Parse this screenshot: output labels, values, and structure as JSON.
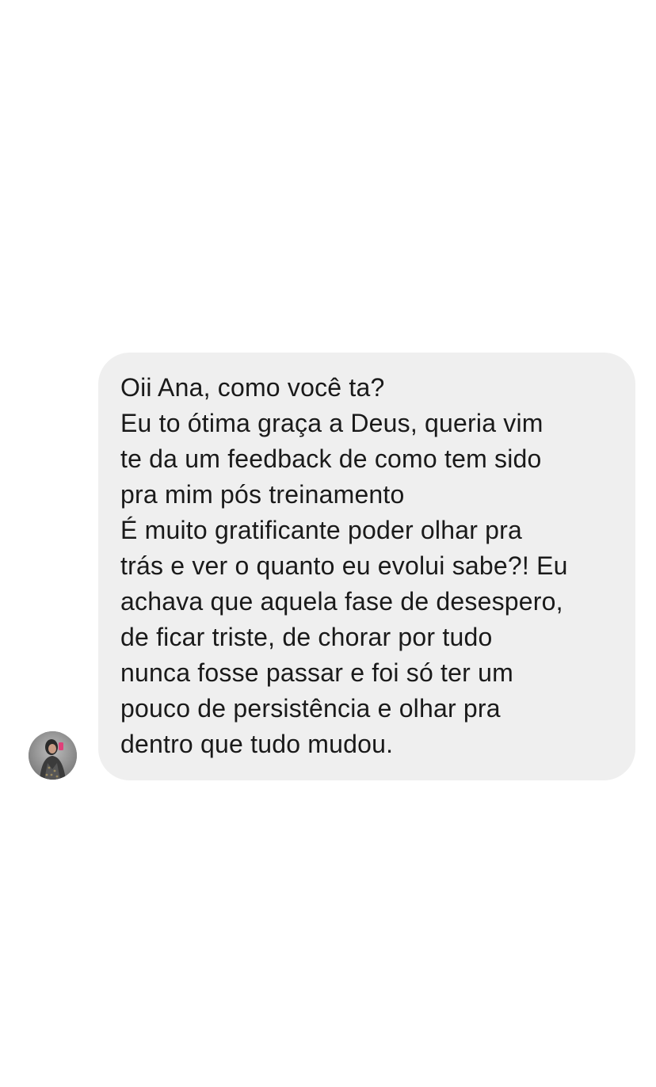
{
  "conversation": {
    "message": {
      "lines": [
        "Oii Ana, como você ta?",
        "Eu to ótima graça a Deus, queria vim",
        "te da um feedback de como tem sido",
        "pra mim pós  treinamento",
        "É muito gratificante poder olhar pra",
        "trás e ver o quanto eu evolui sabe?! Eu",
        "achava que aquela fase de desespero,",
        "de ficar triste, de chorar por tudo",
        "nunca fosse passar e foi só ter um",
        "pouco de persistência e olhar pra",
        "dentro que tudo mudou."
      ]
    },
    "avatar_icon": "user-avatar-photo"
  },
  "colors": {
    "background": "#ffffff",
    "bubble": "#efefef",
    "text": "#1a1a1a"
  }
}
